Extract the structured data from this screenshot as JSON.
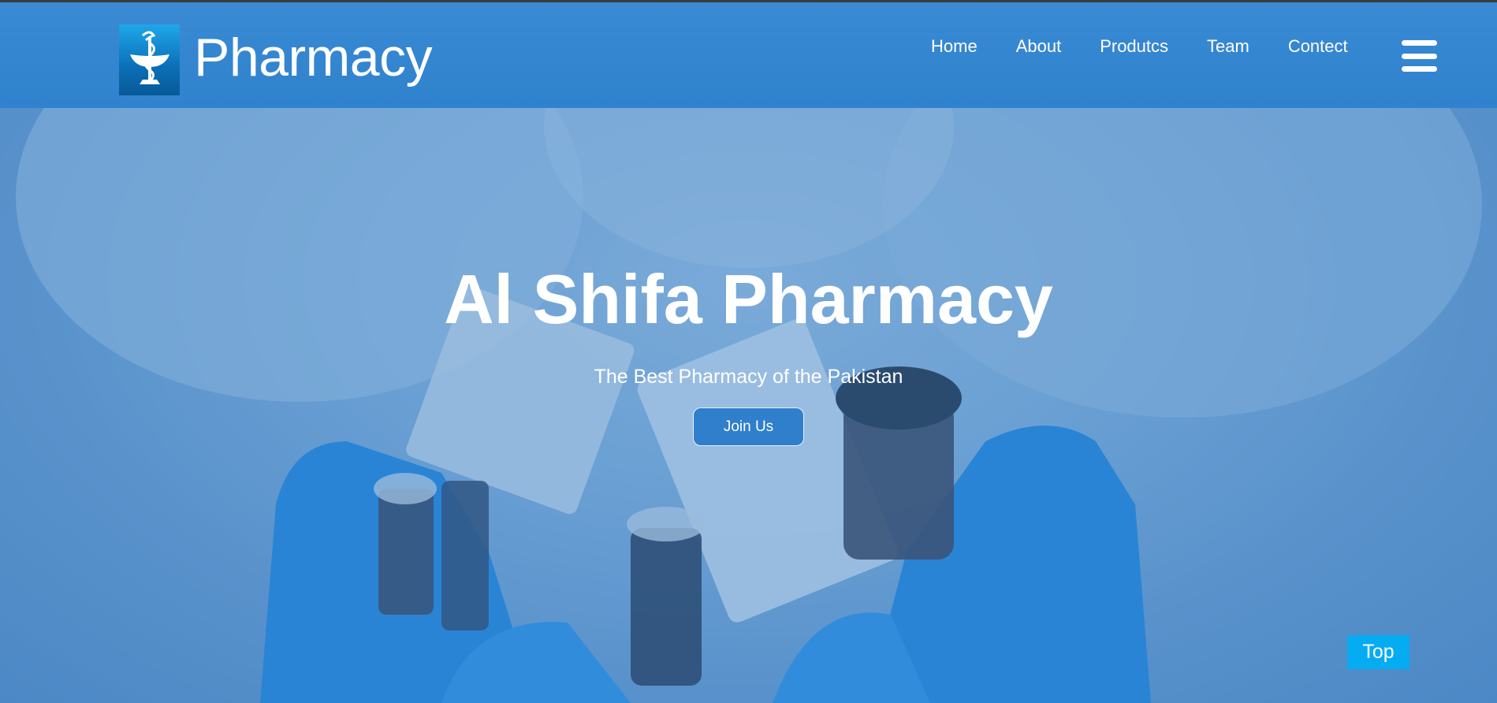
{
  "header": {
    "brand": "Pharmacy",
    "logo_icon": "bowl-of-hygieia-icon",
    "nav": [
      {
        "label": "Home"
      },
      {
        "label": "About"
      },
      {
        "label": "Produtcs"
      },
      {
        "label": "Team"
      },
      {
        "label": "Contect"
      }
    ],
    "menu_icon": "hamburger-menu-icon"
  },
  "hero": {
    "title": "Al Shifa Pharmacy",
    "subtitle": "The Best Pharmacy of the Pakistan",
    "cta_label": "Join Us"
  },
  "scroll_top_label": "Top",
  "colors": {
    "header": "#2f82cd",
    "logo": "#0b6fb7",
    "cta": "#2f7fcc",
    "top_button": "#05acf2",
    "text": "#ffffff"
  }
}
